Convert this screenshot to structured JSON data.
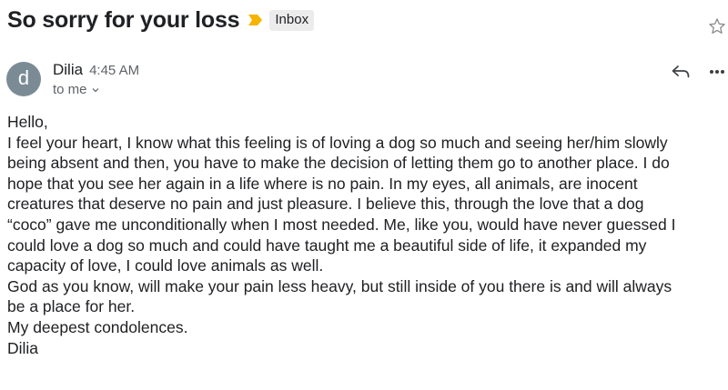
{
  "email": {
    "subject": "So sorry for your loss",
    "label": "Inbox",
    "sender": {
      "initial": "d",
      "name": "Dilia",
      "time": "4:45 AM",
      "recipient": "to me"
    },
    "body_lines": [
      "Hello,",
      "I feel your heart, I know what this feeling is of loving  a dog so much and seeing her/him slowly",
      "being absent and then, you have to make the decision of letting them go to another place. I do",
      "hope that you see her again in a life where is no pain. In my eyes, all animals, are inocent",
      "creatures that deserve no pain and just pleasure. I believe this, through the love that a dog",
      "“coco” gave me unconditionally when I most needed. Me, like you, would have never guessed I",
      "could love a dog so much and could have taught me a beautiful side of life, it expanded my",
      "capacity of love, I could love animals as well.",
      "God as you know,  will make your pain less heavy, but still inside of you there is and will always",
      "be a place for her.",
      "My deepest condolences.",
      "Dilia"
    ]
  },
  "icons": {
    "importance": "importance-marker-icon",
    "star": "star-icon",
    "reply": "reply-icon",
    "more": "more-vertical-icon",
    "chevron": "chevron-down-icon"
  },
  "colors": {
    "importance": "#f5b400",
    "avatar": "#7b8b96",
    "label_bg": "#ececec",
    "secondary_text": "#5f6368"
  }
}
